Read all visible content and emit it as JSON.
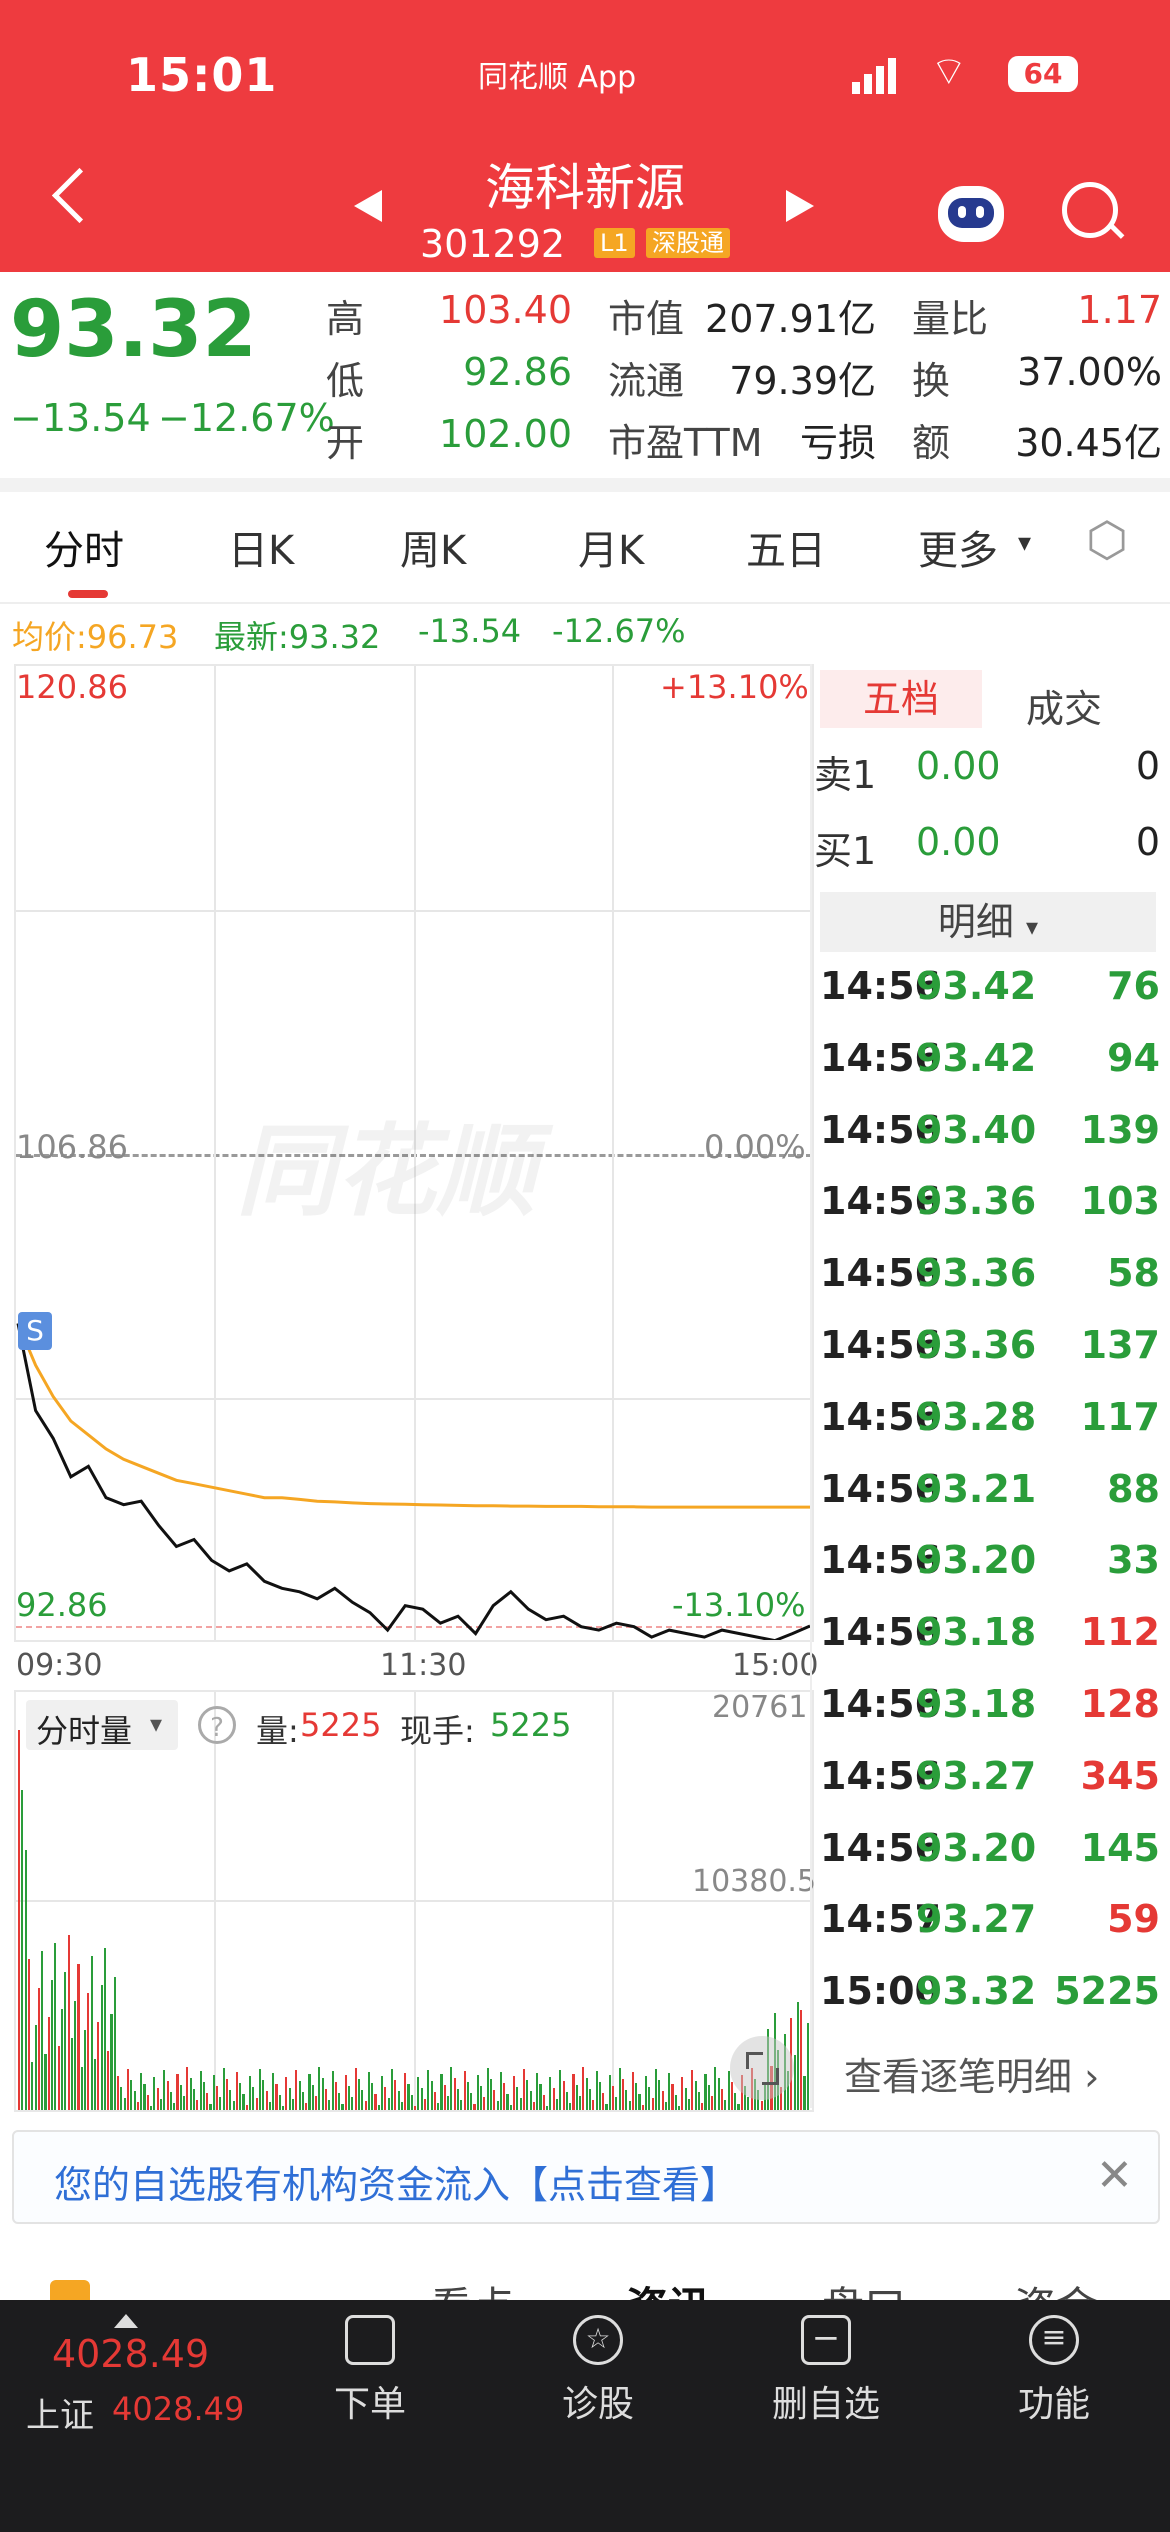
{
  "status": {
    "time": "15:01",
    "app": "同花顺 App",
    "battery": "64"
  },
  "stock": {
    "name": "海科新源",
    "code": "301292",
    "tag_l1": "L1",
    "tag_market": "深股通"
  },
  "quote": {
    "price": "93.32",
    "change": "−13.54",
    "change_pct": "−12.67%",
    "high_label": "高",
    "high": "103.40",
    "low_label": "低",
    "low": "92.86",
    "open_label": "开",
    "open": "102.00",
    "mcap_label": "市值",
    "mcap": "207.91亿",
    "float_label": "流通",
    "float": "79.39亿",
    "pe_label": "市盈TTM",
    "pe": "亏损",
    "vr_label": "量比",
    "vr": "1.17",
    "turnover_label": "换",
    "turnover": "37.00%",
    "amount_label": "额",
    "amount": "30.45亿"
  },
  "tabs": [
    "分时",
    "日K",
    "周K",
    "月K",
    "五日",
    "更多"
  ],
  "summary": {
    "avg": "均价:96.73",
    "latest": "最新:93.32",
    "chg": "-13.54",
    "pct": "-12.67%"
  },
  "chart": {
    "y_top": "120.86",
    "pct_top": "+13.10%",
    "y_mid": "106.86",
    "pct_mid": "0.00%",
    "y_bot": "92.86",
    "pct_bot": "-13.10%",
    "t_start": "09:30",
    "t_mid": "11:30",
    "t_end": "15:00",
    "marker": "S",
    "watermark": "同花顺",
    "vol_title": "分时量",
    "vol_label": "量:",
    "vol_value": "5225",
    "hand_label": "现手:",
    "hand_value": "5225",
    "vol_max": "20761",
    "vol_mid": "10380.5"
  },
  "chart_data": {
    "type": "line",
    "price_range": [
      92.86,
      120.86
    ],
    "reference": 106.86,
    "series": [
      {
        "name": "price",
        "values": [
          102.0,
          99.5,
          98.7,
          97.6,
          97.9,
          97.0,
          96.8,
          96.9,
          96.2,
          95.6,
          95.8,
          95.2,
          94.9,
          95.1,
          94.6,
          94.4,
          94.3,
          94.1,
          94.4,
          94.0,
          93.7,
          93.2,
          93.9,
          93.8,
          93.4,
          93.6,
          93.1,
          93.9,
          94.3,
          93.8,
          93.5,
          93.6,
          93.3,
          93.2,
          93.4,
          93.3,
          93.0,
          93.2,
          93.1,
          93.0,
          93.2,
          93.1,
          93.0,
          92.9,
          93.1,
          93.32
        ]
      },
      {
        "name": "avg",
        "values": [
          102.0,
          100.8,
          99.9,
          99.2,
          98.8,
          98.4,
          98.1,
          97.9,
          97.7,
          97.5,
          97.4,
          97.3,
          97.2,
          97.1,
          97.0,
          97.0,
          96.95,
          96.9,
          96.88,
          96.85,
          96.83,
          96.82,
          96.81,
          96.8,
          96.79,
          96.78,
          96.77,
          96.77,
          96.76,
          96.76,
          96.75,
          96.75,
          96.75,
          96.74,
          96.74,
          96.74,
          96.73,
          96.73,
          96.73,
          96.73,
          96.73,
          96.73,
          96.73,
          96.73,
          96.73,
          96.73
        ]
      }
    ]
  },
  "book": {
    "tab_active": "五档",
    "tab_other": "成交",
    "sell1": {
      "label": "卖1",
      "price": "0.00",
      "vol": "0"
    },
    "buy1": {
      "label": "买1",
      "price": "0.00",
      "vol": "0"
    },
    "detail_label": "明细",
    "trades": [
      {
        "t": "14:56",
        "p": "93.42",
        "v": "76",
        "c": "green"
      },
      {
        "t": "14:56",
        "p": "93.42",
        "v": "94",
        "c": "green"
      },
      {
        "t": "14:56",
        "p": "93.40",
        "v": "139",
        "c": "green"
      },
      {
        "t": "14:56",
        "p": "93.36",
        "v": "103",
        "c": "green"
      },
      {
        "t": "14:56",
        "p": "93.36",
        "v": "58",
        "c": "green"
      },
      {
        "t": "14:56",
        "p": "93.36",
        "v": "137",
        "c": "green"
      },
      {
        "t": "14:56",
        "p": "93.28",
        "v": "117",
        "c": "green"
      },
      {
        "t": "14:56",
        "p": "93.21",
        "v": "88",
        "c": "green"
      },
      {
        "t": "14:56",
        "p": "93.20",
        "v": "33",
        "c": "green"
      },
      {
        "t": "14:56",
        "p": "93.18",
        "v": "112",
        "c": "red"
      },
      {
        "t": "14:56",
        "p": "93.18",
        "v": "128",
        "c": "red"
      },
      {
        "t": "14:56",
        "p": "93.27",
        "v": "345",
        "c": "red"
      },
      {
        "t": "14:56",
        "p": "93.20",
        "v": "145",
        "c": "green"
      },
      {
        "t": "14:57",
        "p": "93.27",
        "v": "59",
        "c": "red"
      },
      {
        "t": "15:00",
        "p": "93.32",
        "v": "5225",
        "c": "green"
      }
    ],
    "more": "查看逐笔明细 ›"
  },
  "notice": {
    "text": "您的自选股有机构资金流入【点击查看】"
  },
  "subtabs": [
    "看点",
    "资讯",
    "盘口",
    "资金"
  ],
  "bottom": {
    "index_value": "4028.49",
    "index_name": "上证",
    "index_value2": "4028.49",
    "items": [
      "下单",
      "诊股",
      "删自选",
      "功能"
    ]
  }
}
